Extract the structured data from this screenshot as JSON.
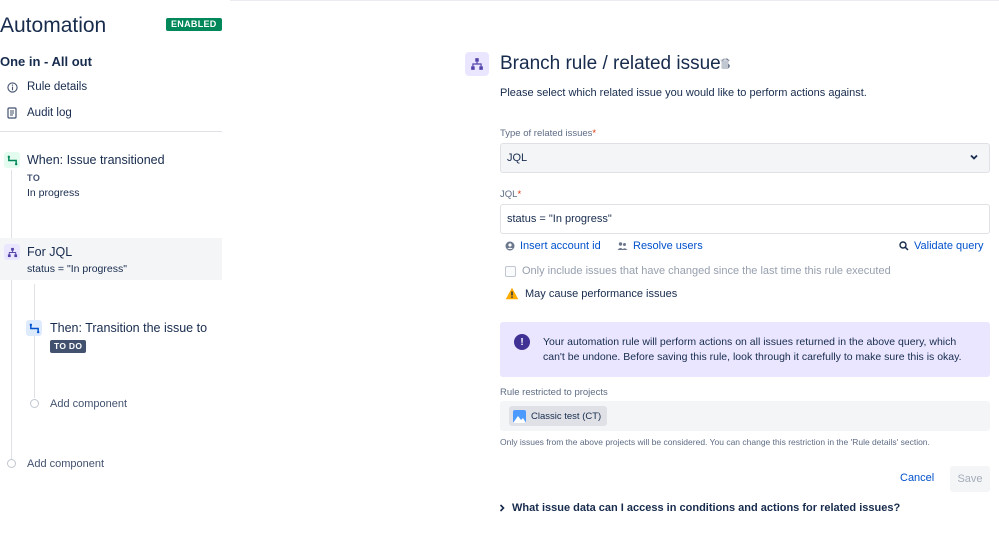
{
  "header": {
    "app_title": "Automation",
    "status_badge": "ENABLED",
    "rule_name": "One in - All out"
  },
  "left_nav": {
    "items": [
      {
        "label": "Rule details",
        "icon": "info-circle-icon"
      },
      {
        "label": "Audit log",
        "icon": "document-icon"
      }
    ]
  },
  "components": {
    "trigger": {
      "title": "When: Issue transitioned",
      "to_label": "TO",
      "status": "In progress"
    },
    "branch": {
      "title": "For JQL",
      "subtitle": "status = \"In progress\""
    },
    "action": {
      "title": "Then: Transition the issue to",
      "lozenge": "TO DO"
    },
    "add_inner": "Add component",
    "add_outer": "Add component"
  },
  "main": {
    "title": "Branch rule / related issues",
    "description": "Please select which related issue you would like to perform actions against.",
    "type_label": "Type of related issues",
    "type_value": "JQL",
    "jql_label": "JQL",
    "jql_value": "status = \"In progress\"",
    "links": {
      "insert_account": "Insert account id",
      "resolve_users": "Resolve users",
      "validate_query": "Validate query"
    },
    "checkbox_label": "Only include issues that have changed since the last time this rule executed",
    "warning": "May cause performance issues",
    "info": "Your automation rule will perform actions on all issues returned in the above query, which can't be undone. Before saving this rule, look through it carefully to make sure this is okay.",
    "restricted_label": "Rule restricted to projects",
    "project_chip": "Classic test (CT)",
    "restriction_note": "Only issues from the above projects will be considered. You can change this restriction in the 'Rule details' section.",
    "cancel": "Cancel",
    "save": "Save",
    "faq": "What issue data can I access in conditions and actions for related issues?"
  },
  "colors": {
    "enabled_badge": "#00875a",
    "link": "#0052cc",
    "info_bg": "#eae6ff",
    "todo_lozenge": "#42526e"
  }
}
